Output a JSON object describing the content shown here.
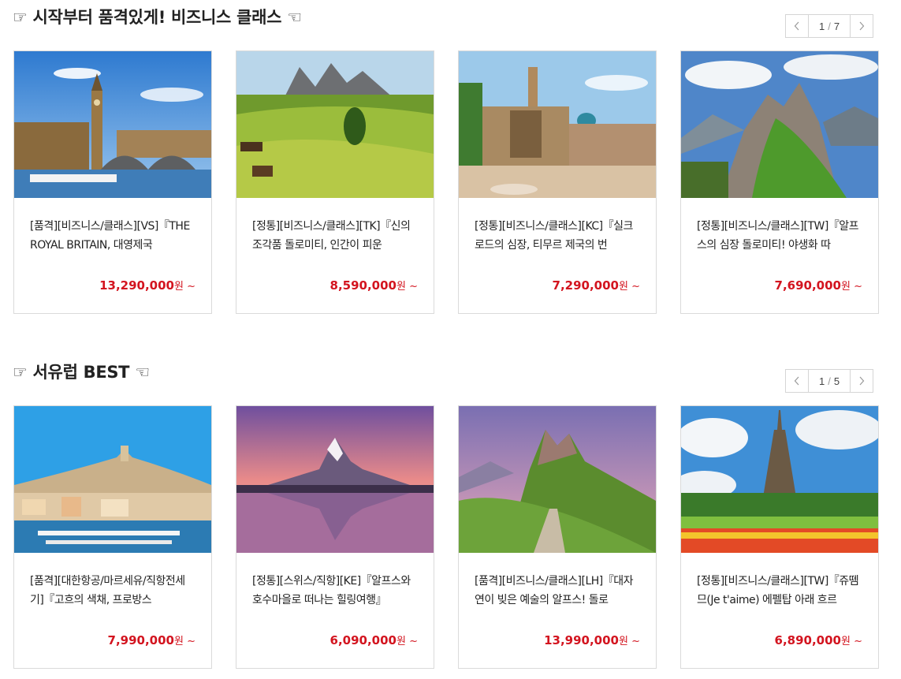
{
  "sections": [
    {
      "title": "☞ 시작부터 품격있게! 비즈니스 클래스 ☜",
      "pager": {
        "current": "1",
        "separator": "/",
        "total": "7"
      },
      "products": [
        {
          "title": "[품격][비즈니스/클래스][VS]『THE ROYAL BRITAIN, 대영제국",
          "price": "13,290,000",
          "unit": "원 ~",
          "image": "london-big-ben"
        },
        {
          "title": "[정통][비즈니스/클래스][TK]『신의 조각품 돌로미티, 인간이 피운",
          "price": "8,590,000",
          "unit": "원 ~",
          "image": "dolomites-meadow"
        },
        {
          "title": "[정통][비즈니스/클래스][KC]『실크로드의 심장, 티무르 제국의 번",
          "price": "7,290,000",
          "unit": "원 ~",
          "image": "samarkand-registan"
        },
        {
          "title": "[정통][비즈니스/클래스][TW]『알프스의 심장 돌로미티! 야생화 따",
          "price": "7,690,000",
          "unit": "원 ~",
          "image": "dolomites-peaks"
        }
      ]
    },
    {
      "title": "☞ 서유럽 BEST ☜",
      "pager": {
        "current": "1",
        "separator": "/",
        "total": "5"
      },
      "products": [
        {
          "title": "[품격][대한항공/마르세유/직항전세기]『고흐의 색채, 프로방스",
          "price": "7,990,000",
          "unit": "원 ~",
          "image": "marseille-harbor"
        },
        {
          "title": "[정통][스위스/직항][KE]『알프스와 호수마을로 떠나는 힐링여행』",
          "price": "6,090,000",
          "unit": "원 ~",
          "image": "matterhorn-reflection"
        },
        {
          "title": "[품격][비즈니스/클래스][LH]『대자연이 빚은 예술의 알프스! 돌로",
          "price": "13,990,000",
          "unit": "원 ~",
          "image": "seceda-ridge"
        },
        {
          "title": "[정통][비즈니스/클래스][TW]『쥬뗌므(Je t'aime) 에펠탑 아래 흐르",
          "price": "6,890,000",
          "unit": "원 ~",
          "image": "eiffel-tulips"
        }
      ]
    }
  ],
  "colors": {
    "price": "#d3141f",
    "border": "#dadada"
  }
}
